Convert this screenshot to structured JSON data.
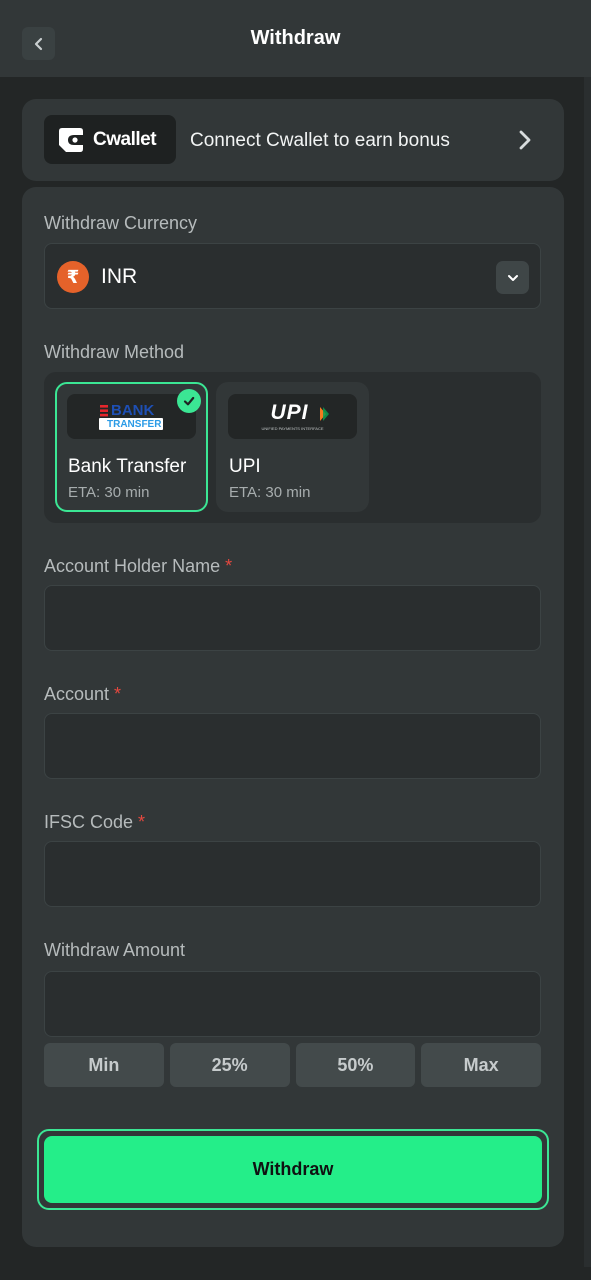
{
  "header": {
    "title": "Withdraw"
  },
  "cwallet": {
    "logo_text": "Cwallet",
    "promo_text": "Connect Cwallet to earn bonus"
  },
  "currency": {
    "label": "Withdraw Currency",
    "symbol": "₹",
    "selected": "INR",
    "icon_color": "#e5622a"
  },
  "method": {
    "label": "Withdraw Method",
    "options": [
      {
        "logo_top": "BANK",
        "logo_bottom": "TRANSFER",
        "name": "Bank Transfer",
        "eta": "ETA: 30 min",
        "selected": true
      },
      {
        "logo_top": "UPI",
        "logo_bottom": "UNIFIED PAYMENTS INTERFACE",
        "name": "UPI",
        "eta": "ETA: 30 min",
        "selected": false
      }
    ]
  },
  "form": {
    "account_holder_label": "Account Holder Name",
    "account_label": "Account",
    "ifsc_label": "IFSC Code",
    "amount_label": "Withdraw Amount",
    "required_mark": "*",
    "account_holder_value": "",
    "account_value": "",
    "ifsc_value": "",
    "amount_value": ""
  },
  "quick_amounts": [
    "Min",
    "25%",
    "50%",
    "Max"
  ],
  "submit": {
    "label": "Withdraw"
  },
  "colors": {
    "accent": "#24ee89",
    "background": "#232626",
    "card": "#323738",
    "required": "#e5483f"
  }
}
